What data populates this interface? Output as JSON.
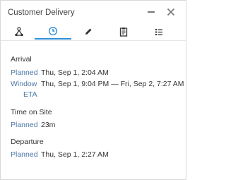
{
  "window": {
    "title": "Customer Delivery"
  },
  "tabs": [
    {
      "icon": "route-icon"
    },
    {
      "icon": "clock-icon",
      "active": true
    },
    {
      "icon": "pencil-icon"
    },
    {
      "icon": "clipboard-icon"
    },
    {
      "icon": "list-icon"
    }
  ],
  "arrival": {
    "heading": "Arrival",
    "planned_label": "Planned",
    "planned_value": "Thu, Sep 1, 2:04 AM",
    "window_label": "Window",
    "window_value": "Thu, Sep 1, 9:04 PM — Fri, Sep 2, 7:27 AM",
    "eta_label": "ETA"
  },
  "time_on_site": {
    "heading": "Time on Site",
    "planned_label": "Planned",
    "planned_value": "23m"
  },
  "departure": {
    "heading": "Departure",
    "planned_label": "Planned",
    "planned_value": "Thu, Sep 1, 2:27 AM"
  },
  "colors": {
    "accent": "#2f8fd6",
    "label": "#4a77a8",
    "text": "#333333"
  }
}
